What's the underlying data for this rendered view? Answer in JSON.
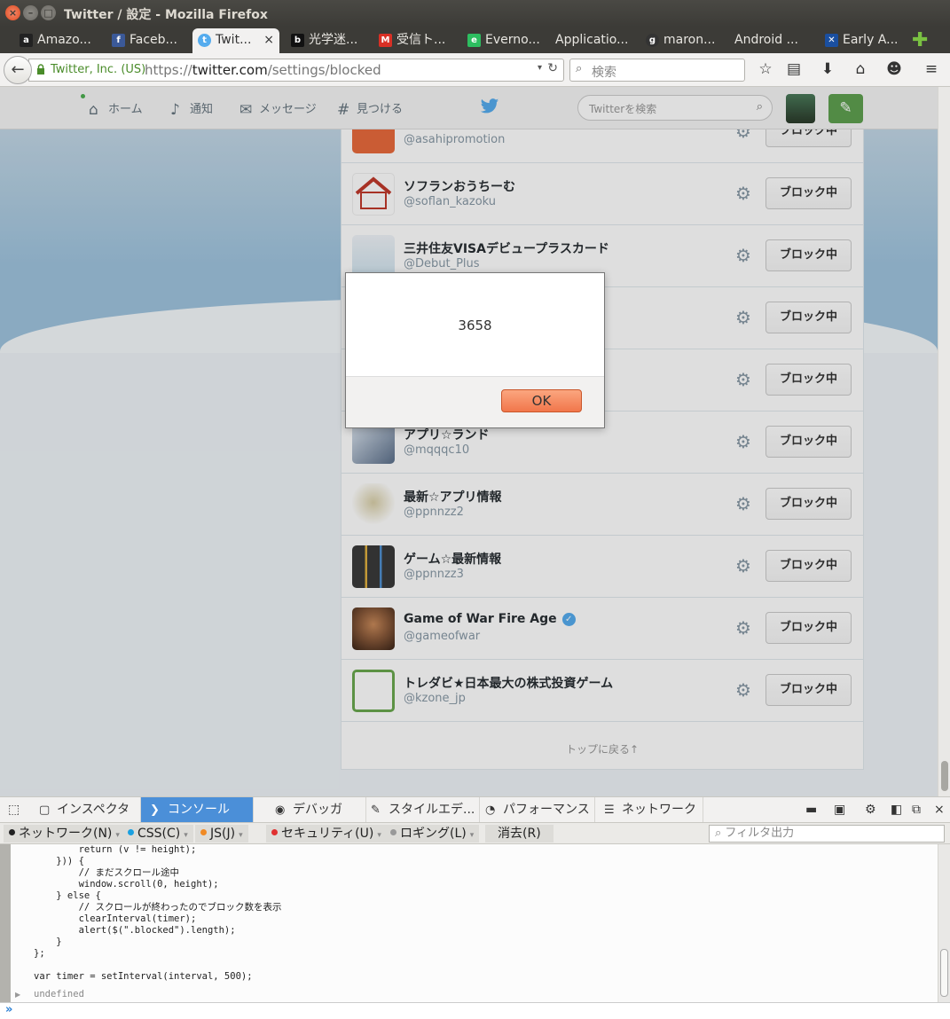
{
  "window": {
    "title": "Twitter / 設定 - Mozilla Firefox",
    "close_glyph": "×",
    "min_glyph": "–",
    "max_glyph": "□"
  },
  "tabs": [
    {
      "label": "Amazo...",
      "icon": "amazon-icon",
      "color": "#222222",
      "glyph": "a"
    },
    {
      "label": "Faceb...",
      "icon": "facebook-icon",
      "color": "#3b5998",
      "glyph": "f"
    },
    {
      "label": "Twit...",
      "icon": "twitter-icon",
      "color": "#55acee",
      "glyph": "t"
    },
    {
      "label": "光学迷...",
      "icon": "hatena-icon",
      "color": "#111111",
      "glyph": "b"
    },
    {
      "label": "受信ト...",
      "icon": "gmail-icon",
      "color": "#d93025",
      "glyph": "M"
    },
    {
      "label": "Everno...",
      "icon": "evernote-icon",
      "color": "#2dbe60",
      "glyph": "e"
    },
    {
      "label": "Applicatio...",
      "icon": "",
      "color": "",
      "glyph": ""
    },
    {
      "label": "maron...",
      "icon": "github-icon",
      "color": "#333333",
      "glyph": "g"
    },
    {
      "label": "Android ...",
      "icon": "",
      "color": "",
      "glyph": ""
    },
    {
      "label": "Early A...",
      "icon": "x-icon",
      "color": "#1a4fa0",
      "glyph": "✕"
    }
  ],
  "active_tab_close": "×",
  "new_tab_glyph": "✚",
  "navbar": {
    "back_glyph": "←",
    "identity": "Twitter, Inc. (US)",
    "url_prefix": "https://",
    "url_host": "twitter.com",
    "url_path": "/settings/blocked",
    "search_placeholder": "検索",
    "search_glyph": "⌕",
    "drop_glyph": "▾",
    "reload_glyph": "↻",
    "icons": [
      "☆",
      "▤",
      "⬇",
      "⌂",
      "☻",
      "≡"
    ]
  },
  "twitter": {
    "nav": [
      {
        "label": "ホーム",
        "icon": "home-icon",
        "glyph": "⌂"
      },
      {
        "label": "通知",
        "icon": "bell-icon",
        "glyph": "♪"
      },
      {
        "label": "メッセージ",
        "icon": "envelope-icon",
        "glyph": "✉"
      },
      {
        "label": "見つける",
        "icon": "hash-icon",
        "glyph": "#"
      }
    ],
    "search_placeholder": "Twitterを検索",
    "search_glyph": "⌕",
    "compose_glyph": "✎",
    "back_to_top": "トップに戻る↑"
  },
  "blocked_accounts": [
    {
      "name": "",
      "handle": "@asahipromotion",
      "button": "ブロック中",
      "avatar": "#e96a3c",
      "verified": false
    },
    {
      "name": "ソフランおうちーむ",
      "handle": "@soflan_kazoku",
      "button": "ブロック中",
      "avatar": "#ffffff",
      "verified": false
    },
    {
      "name": "三井住友VISAデビュープラスカード",
      "handle": "@Debut_Plus",
      "button": "ブロック中",
      "avatar": "#cfe3ef",
      "verified": false
    },
    {
      "name": "",
      "handle": "",
      "button": "ブロック中",
      "avatar": "#ffffff",
      "verified": false
    },
    {
      "name": "",
      "handle": "",
      "button": "ブロック中",
      "avatar": "#ffffff",
      "verified": false
    },
    {
      "name": "アプリ☆ランド",
      "handle": "@mqqqc10",
      "button": "ブロック中",
      "avatar": "#5b6f8a",
      "verified": false
    },
    {
      "name": "最新☆アプリ情報",
      "handle": "@ppnnzz2",
      "button": "ブロック中",
      "avatar": "#d9cfa8",
      "verified": false
    },
    {
      "name": "ゲーム☆最新情報",
      "handle": "@ppnnzz3",
      "button": "ブロック中",
      "avatar": "#3a3a3a",
      "verified": false
    },
    {
      "name": "Game of War Fire Age",
      "handle": "@gameofwar",
      "button": "ブロック中",
      "avatar": "#8a5a3a",
      "verified": true
    },
    {
      "name": "トレダビ★日本最大の株式投資ゲーム",
      "handle": "@kzone_jp",
      "button": "ブロック中",
      "avatar": "#6aa84f",
      "verified": false
    }
  ],
  "gear_glyph": "⚙",
  "verified_glyph": "✓",
  "alert": {
    "message": "3658",
    "ok_label": "OK"
  },
  "devtools": {
    "tabs": [
      {
        "label": "インスペクタ",
        "glyph": "▢"
      },
      {
        "label": "コンソール",
        "glyph": "❯"
      },
      {
        "label": "デバッガ",
        "glyph": "◉"
      },
      {
        "label": "スタイルエデ...",
        "glyph": "✎"
      },
      {
        "label": "パフォーマンス",
        "glyph": "◔"
      },
      {
        "label": "ネットワーク",
        "glyph": "☰"
      }
    ],
    "picker_glyph": "⬚",
    "right_icons": [
      "▬",
      "▣",
      "⚙",
      "◧",
      "⧉",
      "×"
    ],
    "filters": [
      {
        "label": "ネットワーク(N)",
        "color": "#222222"
      },
      {
        "label": "CSS(C)",
        "color": "#1aa0e0"
      },
      {
        "label": "JS(J)",
        "color": "#f08a24"
      },
      {
        "label": "セキュリティ(U)",
        "color": "#e03030"
      },
      {
        "label": "ロギング(L)",
        "color": "#999999"
      }
    ],
    "clear_label": "消去(R)",
    "filter_placeholder": "フィルタ出力",
    "filter_glyph": "⌕",
    "dropdown_glyph": "▾",
    "code": "        return (v != height);\n    })) {\n        // まだスクロール途中\n        window.scroll(0, height);\n    } else {\n        // スクロールが終わったのでブロック数を表示\n        clearInterval(timer);\n        alert($(\".blocked\").length);\n    }\n};\n\nvar timer = setInterval(interval, 500);",
    "result": "undefined",
    "result_arrow": "▶",
    "prompt": "»"
  }
}
